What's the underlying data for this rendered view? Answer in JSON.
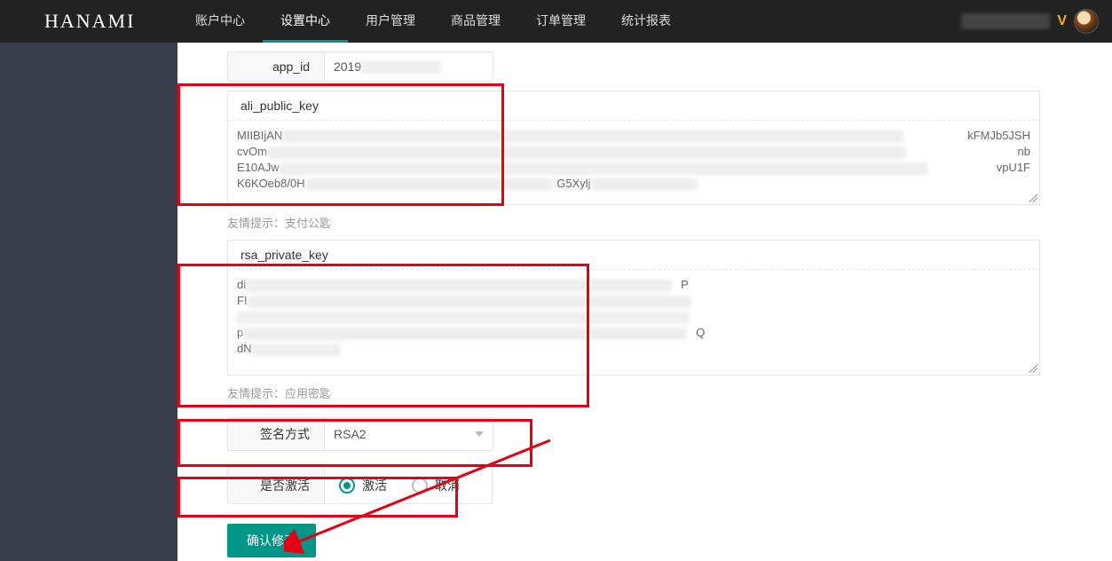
{
  "brand": "HANAMI",
  "nav": {
    "items": [
      {
        "label": "账户中心"
      },
      {
        "label": "设置中心",
        "active": true
      },
      {
        "label": "用户管理"
      },
      {
        "label": "商品管理"
      },
      {
        "label": "订单管理"
      },
      {
        "label": "统计报表"
      }
    ]
  },
  "user": {
    "badge": "V"
  },
  "form": {
    "app_id": {
      "label": "app_id",
      "value": "2019"
    },
    "pubkey": {
      "label": "ali_public_key",
      "lines": [
        "MIIBIjAN",
        "cvOm",
        "E10AJw",
        "K6KOeb8/0H"
      ],
      "tail1": "kFMJb5JSH",
      "tail2": "nb",
      "tail3": "vpU1F",
      "mid": "G5Xylj"
    },
    "hint1": "友情提示：支付公匙",
    "privkey": {
      "label": "rsa_private_key",
      "lines": [
        "di",
        "FI",
        "",
        "p",
        "dN"
      ],
      "side": [
        "P",
        "",
        "",
        "Q"
      ]
    },
    "hint2": "友情提示：应用密匙",
    "sign": {
      "label": "签名方式",
      "value": "RSA2"
    },
    "active": {
      "label": "是否激活",
      "opt1": "激活",
      "opt2": "取消"
    },
    "submit": "确认修改"
  }
}
